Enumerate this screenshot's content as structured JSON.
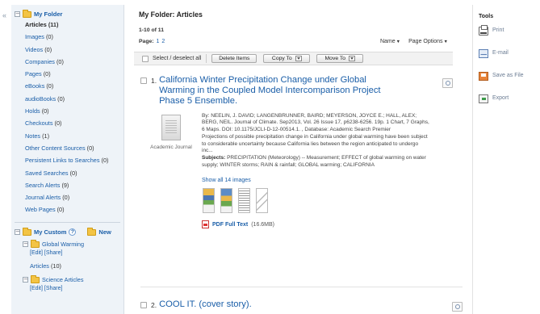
{
  "sidebar": {
    "collapse_glyph": "«",
    "root_label": "My Folder",
    "items": [
      {
        "label": "Articles",
        "count": "(11)",
        "active": true
      },
      {
        "label": "Images",
        "count": "(0)"
      },
      {
        "label": "Videos",
        "count": "(0)"
      },
      {
        "label": "Companies",
        "count": "(0)"
      },
      {
        "label": "Pages",
        "count": "(0)"
      },
      {
        "label": "eBooks",
        "count": "(0)"
      },
      {
        "label": "audioBooks",
        "count": "(0)"
      },
      {
        "label": "Holds",
        "count": "(0)"
      },
      {
        "label": "Checkouts",
        "count": "(0)"
      },
      {
        "label": "Notes",
        "count": "(1)"
      },
      {
        "label": "Other Content Sources",
        "count": "(0)"
      },
      {
        "label": "Persistent Links to Searches",
        "count": "(0)"
      },
      {
        "label": "Saved Searches",
        "count": "(0)"
      },
      {
        "label": "Search Alerts",
        "count": "(9)"
      },
      {
        "label": "Journal Alerts",
        "count": "(0)"
      },
      {
        "label": "Web Pages",
        "count": "(0)"
      }
    ],
    "custom": {
      "label": "My Custom",
      "help": "?",
      "new_label": "New",
      "folders": [
        {
          "label": "Global Warming",
          "links": "[Edit] [Share]",
          "articles_label": "Articles",
          "articles_count": "(10)"
        },
        {
          "label": "Science Articles",
          "links": "[Edit] [Share]"
        }
      ]
    }
  },
  "main": {
    "title": "My Folder: Articles",
    "range": "1-10 of 11",
    "page_label": "Page:",
    "pages": [
      "1",
      "2"
    ],
    "sort_name": "Name",
    "page_options": "Page Options",
    "toolbar": {
      "select_all": "Select / deselect all",
      "delete": "Delete Items",
      "copy": "Copy To",
      "move": "Move To"
    },
    "results": [
      {
        "num": "1.",
        "title": "California Winter Precipitation Change under Global Warming in the Coupled Model Intercomparison Project Phase 5 Ensemble.",
        "doc_type": "Academic Journal",
        "citation": "By: NEELIN, J. DAVID; LANGENBRUNNER, BAIRD; MEYERSON, JOYCE E.; HALL, ALEX; BERG, NEIL. Journal of Climate. Sep2013, Vol. 26 Issue 17, p6238-6256. 19p. 1 Chart, 7 Graphs, 6 Maps. DOI: 10.1175/JCLI-D-12-00514.1. , Database: Academic Search Premier",
        "abstract": "Projections of possible precipitation change in California under global warming have been subject to considerable uncertainty because California lies between the region anticipated to undergo inc...",
        "subjects_label": "Subjects:",
        "subjects": "PRECIPITATION (Meteorology) -- Measurement; EFFECT of global warming on water supply; WINTER storms; RAIN & rainfall; GLOBAL warming; CALIFORNIA",
        "show_images": "Show all 14 images",
        "pdf_label": "PDF Full Text",
        "pdf_size": "(16.6MB)"
      },
      {
        "num": "2.",
        "title": "COOL IT. (cover story)."
      }
    ]
  },
  "tools": {
    "title": "Tools",
    "items": [
      {
        "label": "Print",
        "icon": "printer-icon"
      },
      {
        "label": "E-mail",
        "icon": "email-icon"
      },
      {
        "label": "Save as File",
        "icon": "save-icon"
      },
      {
        "label": "Export",
        "icon": "export-icon"
      }
    ]
  },
  "colors": {
    "link": "#1a5ea8",
    "sidebar_bg": "#eef3f8",
    "folder": "#f3c445"
  }
}
